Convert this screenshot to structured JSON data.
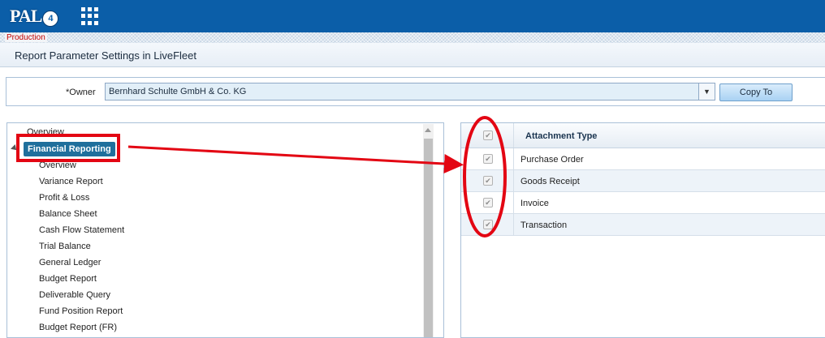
{
  "app": {
    "logo_text": "PAL",
    "logo_badge": "4",
    "environment": "Production",
    "page_title": "Report Parameter Settings in LiveFleet",
    "colors": {
      "header": "#0b5ea8",
      "selected": "#1f6f9c",
      "annotation": "#e30613"
    }
  },
  "owner": {
    "label": "*Owner",
    "value": "Bernhard Schulte GmbH & Co. KG",
    "copy_button": "Copy To"
  },
  "tree": {
    "root_label": "Overview",
    "selected_label": "Financial Reporting",
    "children": [
      "Overview",
      "Variance Report",
      "Profit & Loss",
      "Balance Sheet",
      "Cash Flow Statement",
      "Trial Balance",
      "General Ledger",
      "Budget Report",
      "Deliverable Query",
      "Fund Position Report",
      "Budget Report (FR)"
    ]
  },
  "grid": {
    "column_header": "Attachment Type",
    "header_checked": true,
    "rows": [
      {
        "label": "Purchase Order",
        "checked": true
      },
      {
        "label": "Goods Receipt",
        "checked": true
      },
      {
        "label": "Invoice",
        "checked": true
      },
      {
        "label": "Transaction",
        "checked": true
      }
    ]
  }
}
